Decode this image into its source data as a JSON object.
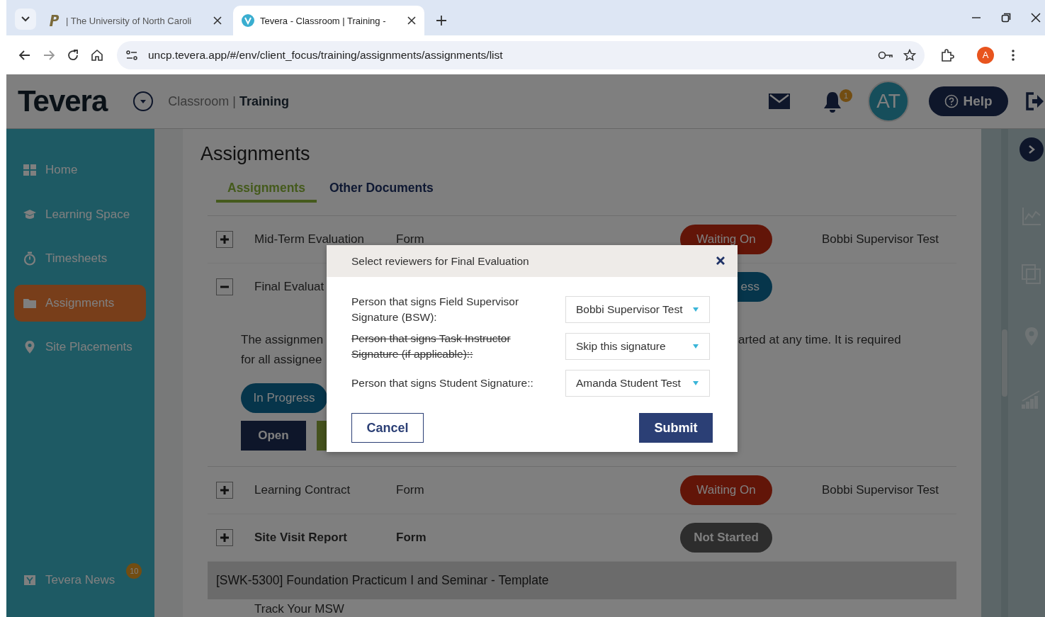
{
  "browser": {
    "tabs": [
      {
        "title": "| The University of North Caroli",
        "selected": false
      },
      {
        "title": "Tevera - Classroom | Training -",
        "selected": true
      }
    ],
    "url": "uncp.tevera.app/#/env/client_focus/training/assignments/assignments/list",
    "profile": "A"
  },
  "header": {
    "logo": "Tevera",
    "context": "Classroom | **Training**",
    "notifications": "1",
    "avatar": "AT",
    "help": "Help"
  },
  "sidebar": {
    "items": [
      {
        "label": "Home",
        "selected": false
      },
      {
        "label": "Learning Space",
        "selected": false
      },
      {
        "label": "Timesheets",
        "selected": false
      },
      {
        "label": "Assignments",
        "selected": true
      },
      {
        "label": "Site Placements",
        "selected": false
      }
    ],
    "news": {
      "label": "Tevera News",
      "badge": "10"
    }
  },
  "page": {
    "title": "Assignments",
    "tabs": [
      {
        "label": "Assignments",
        "selected": true
      },
      {
        "label": "Other Documents",
        "selected": false
      }
    ],
    "rows": [
      {
        "kind": "row",
        "expanded": false,
        "name": "Mid-Term Evaluation",
        "bold": false,
        "type": "Form",
        "status": {
          "label": "Waiting On",
          "kind": "waiting"
        },
        "person": "Bobbi Supervisor Test"
      },
      {
        "kind": "row",
        "expanded": true,
        "name": "Final Evaluat",
        "bold": false,
        "status": {
          "label": "ess",
          "kind": "progress"
        },
        "detail": {
          "left_lines": [
            "The assignmen",
            "for all assignee"
          ],
          "right_text": "arted at any time. It is required",
          "status": {
            "label": "In Progress",
            "kind": "progress"
          },
          "open": "Open"
        }
      },
      {
        "kind": "row",
        "expanded": false,
        "name": "Learning Contract",
        "bold": false,
        "type": "Form",
        "status": {
          "label": "Waiting On",
          "kind": "waiting"
        },
        "person": "Bobbi Supervisor Test"
      },
      {
        "kind": "row",
        "expanded": false,
        "name": "Site Visit Report",
        "bold": true,
        "type": "Form",
        "status": {
          "label": "Not Started",
          "kind": "not_started"
        }
      },
      {
        "kind": "group",
        "name": "[SWK-5300] Foundation Practicum I and Seminar - Template"
      },
      {
        "kind": "partial",
        "name": "Track Your MSW"
      }
    ]
  },
  "modal": {
    "title": "Select reviewers for Final Evaluation",
    "fields": [
      {
        "label": "Person that signs Field Supervisor Signature (BSW):",
        "struck": false,
        "value": "Bobbi Supervisor Test"
      },
      {
        "label": "Person that signs Task Instructor Signature (if applicable)::",
        "struck": true,
        "value": "Skip this signature"
      },
      {
        "label": "Person that signs Student Signature::",
        "struck": false,
        "value": "Amanda Student Test"
      }
    ],
    "cancel": "Cancel",
    "submit": "Submit"
  }
}
